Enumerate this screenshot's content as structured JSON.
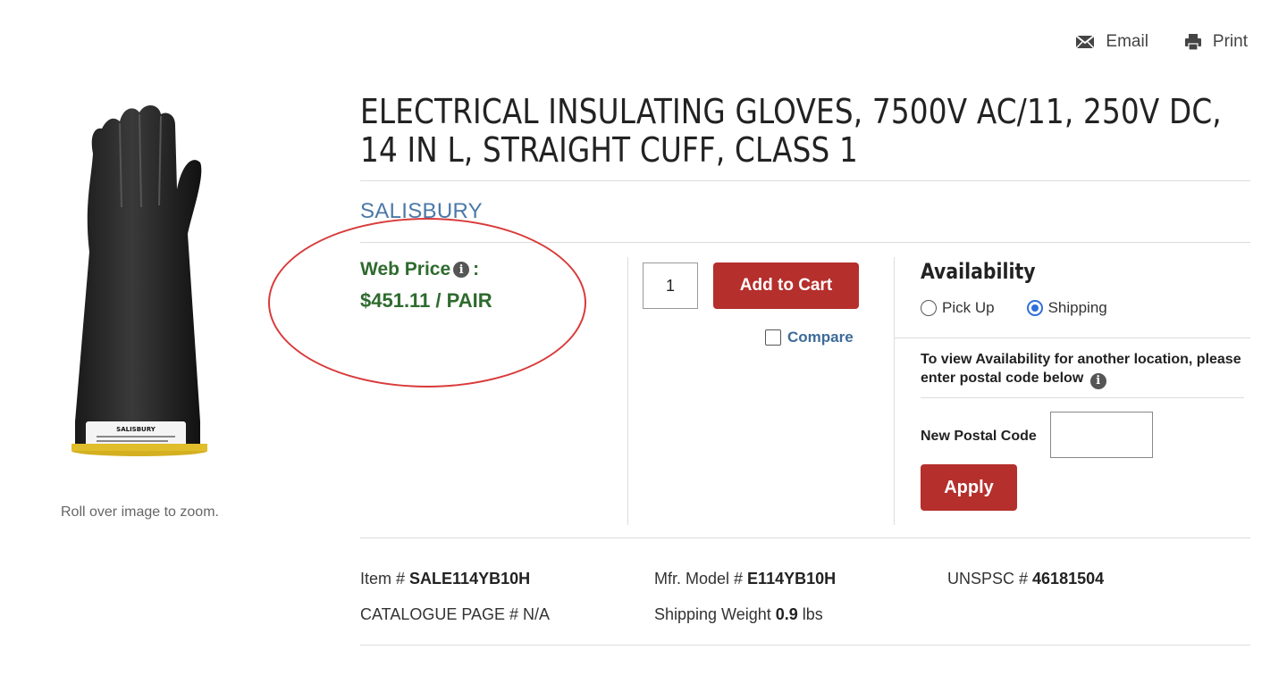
{
  "actions": {
    "email": "Email",
    "print": "Print"
  },
  "image": {
    "zoom_hint": "Roll over image to zoom.",
    "glove_label": "SALISBURY"
  },
  "product": {
    "title": "ELECTRICAL INSULATING GLOVES, 7500V AC/11, 250V DC, 14 IN L, STRAIGHT CUFF, CLASS 1",
    "brand": "SALISBURY"
  },
  "price": {
    "label": "Web Price",
    "suffix": ":",
    "value": "$451.11 / PAIR"
  },
  "cart": {
    "quantity": "1",
    "add_label": "Add to Cart",
    "compare_label": "Compare"
  },
  "availability": {
    "title": "Availability",
    "options": [
      "Pick Up",
      "Shipping"
    ],
    "selected": "Shipping",
    "note": "To view Availability for another location, please enter postal code below",
    "postal_label": "New Postal Code",
    "postal_value": "",
    "apply_label": "Apply"
  },
  "details": {
    "item_label": "Item # ",
    "item_value": "SALE114YB10H",
    "model_label": "Mfr. Model # ",
    "model_value": "E114YB10H",
    "unspsc_label": "UNSPSC # ",
    "unspsc_value": "46181504",
    "catalogue": "CATALOGUE PAGE # N/A",
    "weight_label": "Shipping Weight ",
    "weight_value": "0.9",
    "weight_unit": " lbs"
  },
  "colors": {
    "price_green": "#2e6b2e",
    "button_red": "#b52f2c",
    "brand_blue": "#4a78a8",
    "annotation_red": "#d93a3a"
  }
}
